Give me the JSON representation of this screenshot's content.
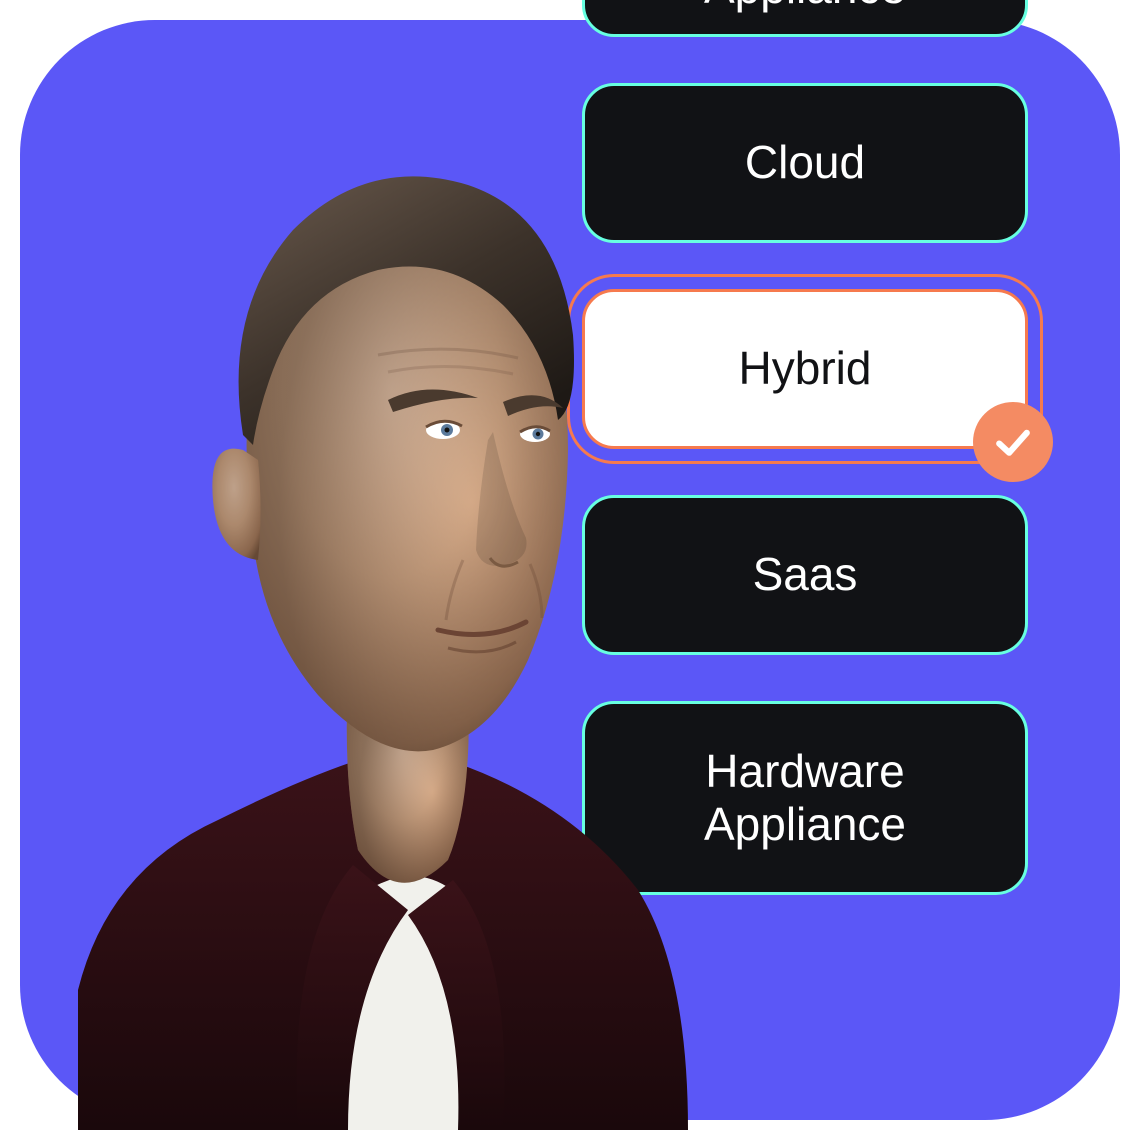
{
  "options": {
    "item0": "Appliance",
    "item1": "Cloud",
    "item2": "Hybrid",
    "item3": "Saas",
    "item4": "Hardware\nAppliance"
  },
  "selected_index": 2,
  "colors": {
    "background": "#5b57f7",
    "option_bg": "#111215",
    "option_border": "#67ffe1",
    "selected_bg": "#ffffff",
    "selected_border": "#f67a4e",
    "check_badge": "#f48b63"
  },
  "icon": {
    "check": "checkmark-icon"
  }
}
